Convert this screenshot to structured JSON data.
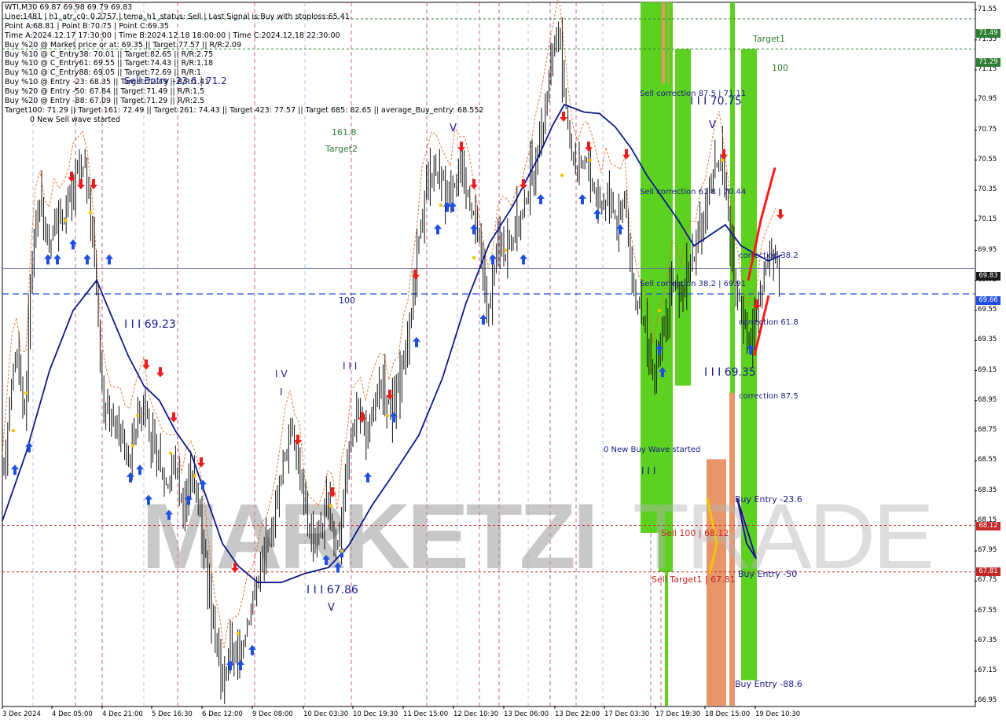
{
  "header": {
    "title": "WTI,M30  69.87 69.98 69.79 69.83",
    "lines": [
      "Line:1481  |  h1_atr_c0: 0.2757  |  tema_h1_status: Sell  |  Last Signal is:Buy with stoploss:65.41",
      "Point A:68.81  |  Point B:70.75  |  Point C:69.35",
      "Time A:2024.12.17 17:30:00  |  Time B:2024.12.18 18:00:00  |  Time C:2024.12.18 22:30:00",
      "Buy %20 @ Market price or at: 69.35  ||  Target:77.57  ||  R/R:2.09",
      "Buy %10 @ C_Entry38: 70.01  ||  Target:82.65  ||  R/R:2.75",
      "Buy %10 @ C_Entry61: 69.55  ||  Target:74.43  ||  R/R:1.18",
      "Buy %10 @ C_Entry88: 69.05  ||  Target:72.69  ||  R/R:1",
      "Buy %10 @ Entry -23: 68.35  ||  Target:72.49  ||  R/R:1.41",
      "Buy %20 @ Entry -50: 67.84  ||  Target:71.49  ||  R/R:1.5",
      "Buy %20 @ Entry -88: 67.09  ||  Target:71.29  ||  R/R:2.5",
      "Target100: 71.29  ||  Target 161: 72.49  ||  Target 261: 74.43  ||  Target 423: 77.57  ||  Target 685: 82.65  ||  average_Buy_entry: 68.552",
      "0 New Sell wave started"
    ]
  },
  "annotations": [
    {
      "id": "sell-entry-label",
      "text": "Sell Entry -23.6 | 71.2",
      "color": "#1a1a8c",
      "size": 12
    },
    {
      "id": "target2-value",
      "text": "161.8",
      "color": "#2e7d32",
      "size": 11
    },
    {
      "id": "target2-label",
      "text": "Target2",
      "color": "#2e7d32",
      "size": 11
    },
    {
      "id": "target1-label",
      "text": "Target1",
      "color": "#2e7d32",
      "size": 11
    },
    {
      "id": "target1-value",
      "text": "100",
      "color": "#2e7d32",
      "size": 11
    },
    {
      "id": "wave-69-23",
      "text": "I I I 69.23",
      "color": "#1a1a8c",
      "size": 14
    },
    {
      "id": "wave-iv",
      "text": "I V",
      "color": "#1a1a8c",
      "size": 12
    },
    {
      "id": "wave-i",
      "text": "I",
      "color": "#1a1a8c",
      "size": 12
    },
    {
      "id": "wave-iii",
      "text": "I I I",
      "color": "#1a1a8c",
      "size": 12
    },
    {
      "id": "wave-67-86",
      "text": "I I I 67.86",
      "color": "#1a1a8c",
      "size": 14
    },
    {
      "id": "wave-v-bottom",
      "text": "V",
      "color": "#1a1a8c",
      "size": 13
    },
    {
      "id": "wave-v-top",
      "text": "V",
      "color": "#1a1a8c",
      "size": 13
    },
    {
      "id": "level-100",
      "text": "100",
      "color": "#1a1a8c",
      "size": 11
    },
    {
      "id": "sell-correction-875",
      "text": "Sell correction 87.5 | 71.11",
      "color": "#1a1a8c",
      "size": 10
    },
    {
      "id": "wave-70-75",
      "text": "I I I 70.75",
      "color": "#1a1a8c",
      "size": 14
    },
    {
      "id": "wave-v-right",
      "text": "V",
      "color": "#1a1a8c",
      "size": 13
    },
    {
      "id": "sell-correction-618",
      "text": "Sell correction 61.8 | 70.44",
      "color": "#1a1a8c",
      "size": 10
    },
    {
      "id": "sell-correction-382",
      "text": "Sell correction 38.2 | 69.91",
      "color": "#1a1a8c",
      "size": 10
    },
    {
      "id": "correction-382",
      "text": "correction 38.2",
      "color": "#1a1a8c",
      "size": 10
    },
    {
      "id": "correction-618",
      "text": "correction 61.8",
      "color": "#1a1a8c",
      "size": 10
    },
    {
      "id": "wave-69-35",
      "text": "I I I 69.35",
      "color": "#1a1a8c",
      "size": 14
    },
    {
      "id": "correction-875",
      "text": "correction 87.5",
      "color": "#1a1a8c",
      "size": 10
    },
    {
      "id": "new-buy-wave",
      "text": "0 New Buy Wave started",
      "color": "#1a1a8c",
      "size": 10
    },
    {
      "id": "wave-iii-bottom",
      "text": "I I I",
      "color": "#1a1a8c",
      "size": 12
    },
    {
      "id": "buy-entry-236",
      "text": "Buy Entry -23.6",
      "color": "#1a1a8c",
      "size": 11
    },
    {
      "id": "sell-100",
      "text": "Sell 100 | 68.12",
      "color": "#c62828",
      "size": 11
    },
    {
      "id": "buy-entry-50",
      "text": "Buy Entry -50",
      "color": "#1a1a8c",
      "size": 11
    },
    {
      "id": "sell-target1",
      "text": "Sell Target1 | 67.81",
      "color": "#c62828",
      "size": 11
    },
    {
      "id": "buy-entry-886",
      "text": "Buy Entry -88.6",
      "color": "#1a1a8c",
      "size": 11
    }
  ],
  "price_tags": [
    {
      "value": "71.49",
      "bg": "#2e7d32"
    },
    {
      "value": "71.29",
      "bg": "#2e7d32"
    },
    {
      "value": "69.83",
      "bg": "#1a1a1a"
    },
    {
      "value": "69.66",
      "bg": "#1f4fe0"
    },
    {
      "value": "68.12",
      "bg": "#c62828"
    },
    {
      "value": "67.81",
      "bg": "#c62828"
    }
  ],
  "chart_data": {
    "type": "candlestick",
    "symbol": "WTI",
    "timeframe": "M30",
    "ohlc_current": {
      "open": 69.87,
      "high": 69.98,
      "low": 69.79,
      "close": 69.83
    },
    "y_ticks": [
      "71.55",
      "71.35",
      "71.15",
      "70.95",
      "70.75",
      "70.55",
      "70.35",
      "70.15",
      "69.95",
      "69.75",
      "69.55",
      "69.35",
      "69.15",
      "68.95",
      "68.75",
      "68.55",
      "68.35",
      "68.15",
      "67.95",
      "67.75",
      "67.55",
      "67.35",
      "67.15",
      "66.95"
    ],
    "ylim": [
      66.92,
      71.6
    ],
    "x_ticks": [
      "3 Dec 2024",
      "4 Dec 05:00",
      "4 Dec 21:00",
      "5 Dec 16:30",
      "6 Dec 12:00",
      "9 Dec 08:00",
      "10 Dec 03:30",
      "10 Dec 19:30",
      "11 Dec 15:00",
      "12 Dec 10:30",
      "13 Dec 06:00",
      "13 Dec 22:00",
      "17 Dec 03:30",
      "17 Dec 19:30",
      "18 Dec 15:00",
      "19 Dec 10:30"
    ],
    "levels": [
      {
        "name": "Target2",
        "value": 71.49,
        "color": "#2e7d32",
        "style": "dashed"
      },
      {
        "name": "Target1",
        "value": 71.29,
        "color": "#2e7d32",
        "style": "dashed"
      },
      {
        "name": "current",
        "value": 69.83,
        "color": "#6d7aa0",
        "style": "solid"
      },
      {
        "name": "average_Buy_entry",
        "value": 69.66,
        "color": "#1f4fe0",
        "style": "dashed"
      },
      {
        "name": "Sell 100",
        "value": 68.12,
        "color": "#c62828",
        "style": "dashed"
      },
      {
        "name": "Sell Target1",
        "value": 67.81,
        "color": "#c62828",
        "style": "dashed"
      }
    ],
    "price_path": [
      [
        0,
        68.35
      ],
      [
        8,
        68.9
      ],
      [
        18,
        69.3
      ],
      [
        28,
        68.85
      ],
      [
        38,
        69.95
      ],
      [
        48,
        70.3
      ],
      [
        58,
        69.95
      ],
      [
        68,
        70.15
      ],
      [
        80,
        70.2
      ],
      [
        95,
        70.45
      ],
      [
        105,
        70.5
      ],
      [
        112,
        70.2
      ],
      [
        120,
        69.7
      ],
      [
        128,
        68.9
      ],
      [
        140,
        68.8
      ],
      [
        150,
        68.75
      ],
      [
        160,
        68.55
      ],
      [
        170,
        68.8
      ],
      [
        180,
        68.95
      ],
      [
        190,
        68.65
      ],
      [
        200,
        68.5
      ],
      [
        210,
        68.4
      ],
      [
        220,
        68.55
      ],
      [
        230,
        68.2
      ],
      [
        240,
        68.5
      ],
      [
        250,
        68.25
      ],
      [
        258,
        67.95
      ],
      [
        266,
        67.6
      ],
      [
        274,
        67.25
      ],
      [
        282,
        67.05
      ],
      [
        290,
        67.35
      ],
      [
        300,
        67.2
      ],
      [
        310,
        67.45
      ],
      [
        320,
        67.65
      ],
      [
        330,
        67.9
      ],
      [
        340,
        68.05
      ],
      [
        350,
        68.3
      ],
      [
        360,
        68.6
      ],
      [
        368,
        68.8
      ],
      [
        376,
        68.55
      ],
      [
        386,
        68.2
      ],
      [
        396,
        68.0
      ],
      [
        406,
        68.1
      ],
      [
        416,
        68.25
      ],
      [
        426,
        67.95
      ],
      [
        434,
        68.35
      ],
      [
        444,
        68.7
      ],
      [
        454,
        68.95
      ],
      [
        464,
        68.65
      ],
      [
        474,
        68.95
      ],
      [
        484,
        69.05
      ],
      [
        494,
        68.85
      ],
      [
        504,
        69.05
      ],
      [
        514,
        69.3
      ],
      [
        524,
        69.75
      ],
      [
        532,
        70.15
      ],
      [
        540,
        70.35
      ],
      [
        550,
        70.45
      ],
      [
        560,
        70.4
      ],
      [
        570,
        70.3
      ],
      [
        580,
        70.55
      ],
      [
        590,
        70.35
      ],
      [
        600,
        70.2
      ],
      [
        610,
        69.85
      ],
      [
        620,
        69.5
      ],
      [
        630,
        70.05
      ],
      [
        640,
        69.95
      ],
      [
        650,
        70.05
      ],
      [
        660,
        70.15
      ],
      [
        670,
        70.4
      ],
      [
        680,
        70.55
      ],
      [
        690,
        70.85
      ],
      [
        698,
        71.2
      ],
      [
        706,
        71.4
      ],
      [
        714,
        71.1
      ],
      [
        722,
        70.65
      ],
      [
        732,
        70.45
      ],
      [
        742,
        70.55
      ],
      [
        752,
        70.35
      ],
      [
        762,
        70.25
      ],
      [
        772,
        70.35
      ],
      [
        782,
        70.15
      ],
      [
        792,
        70.3
      ],
      [
        800,
        69.75
      ],
      [
        810,
        69.55
      ],
      [
        820,
        69.35
      ],
      [
        828,
        69.05
      ],
      [
        836,
        69.3
      ],
      [
        844,
        69.5
      ],
      [
        852,
        69.75
      ],
      [
        862,
        69.6
      ],
      [
        872,
        69.85
      ],
      [
        882,
        69.95
      ],
      [
        892,
        70.15
      ],
      [
        902,
        70.4
      ],
      [
        912,
        70.6
      ],
      [
        920,
        70.35
      ],
      [
        928,
        69.95
      ],
      [
        936,
        69.65
      ],
      [
        944,
        69.45
      ],
      [
        952,
        69.35
      ],
      [
        960,
        69.5
      ],
      [
        968,
        69.75
      ],
      [
        978,
        69.95
      ],
      [
        986,
        69.9
      ],
      [
        992,
        69.83
      ]
    ],
    "ma_path": [
      [
        0,
        68.15
      ],
      [
        30,
        68.6
      ],
      [
        60,
        69.15
      ],
      [
        90,
        69.55
      ],
      [
        120,
        69.75
      ],
      [
        140,
        69.5
      ],
      [
        160,
        69.25
      ],
      [
        180,
        69.05
      ],
      [
        200,
        68.95
      ],
      [
        220,
        68.75
      ],
      [
        240,
        68.6
      ],
      [
        260,
        68.3
      ],
      [
        280,
        68.0
      ],
      [
        300,
        67.85
      ],
      [
        325,
        67.74
      ],
      [
        355,
        67.74
      ],
      [
        385,
        67.8
      ],
      [
        415,
        67.84
      ],
      [
        440,
        67.98
      ],
      [
        470,
        68.25
      ],
      [
        500,
        68.48
      ],
      [
        530,
        68.72
      ],
      [
        560,
        69.1
      ],
      [
        590,
        69.6
      ],
      [
        620,
        70.0
      ],
      [
        650,
        70.25
      ],
      [
        680,
        70.55
      ],
      [
        700,
        70.78
      ],
      [
        715,
        70.92
      ],
      [
        740,
        70.87
      ],
      [
        760,
        70.86
      ],
      [
        780,
        70.77
      ],
      [
        800,
        70.63
      ],
      [
        820,
        70.45
      ],
      [
        840,
        70.3
      ],
      [
        860,
        70.15
      ],
      [
        880,
        69.98
      ],
      [
        900,
        70.05
      ],
      [
        920,
        70.12
      ],
      [
        940,
        69.98
      ],
      [
        960,
        69.92
      ],
      [
        975,
        69.88
      ],
      [
        992,
        69.92
      ]
    ],
    "zones": [
      {
        "color": "#5cd11f",
        "price_top": 71.6,
        "price_bottom": 68.07
      },
      {
        "color": "#5cd11f",
        "price_top": 71.6,
        "price_bottom": 67.81
      },
      {
        "color": "#e8956a",
        "price_top": 71.6,
        "price_bottom": 71.06
      },
      {
        "color": "#5cd11f",
        "price_top": 71.6,
        "price_bottom": 66.92
      },
      {
        "color": "#5cd11f",
        "price_top": 71.29,
        "price_bottom": 69.05
      },
      {
        "color": "#e8956a",
        "price_top": 68.56,
        "price_bottom": 66.92
      },
      {
        "color": "#5cd11f",
        "price_top": 71.6,
        "price_bottom": 66.92
      },
      {
        "color": "#5cd11f",
        "price_top": 71.29,
        "price_bottom": 67.09
      },
      {
        "color": "#e8956a",
        "price_top": 69.0,
        "price_bottom": 66.92
      }
    ],
    "grid": true
  }
}
